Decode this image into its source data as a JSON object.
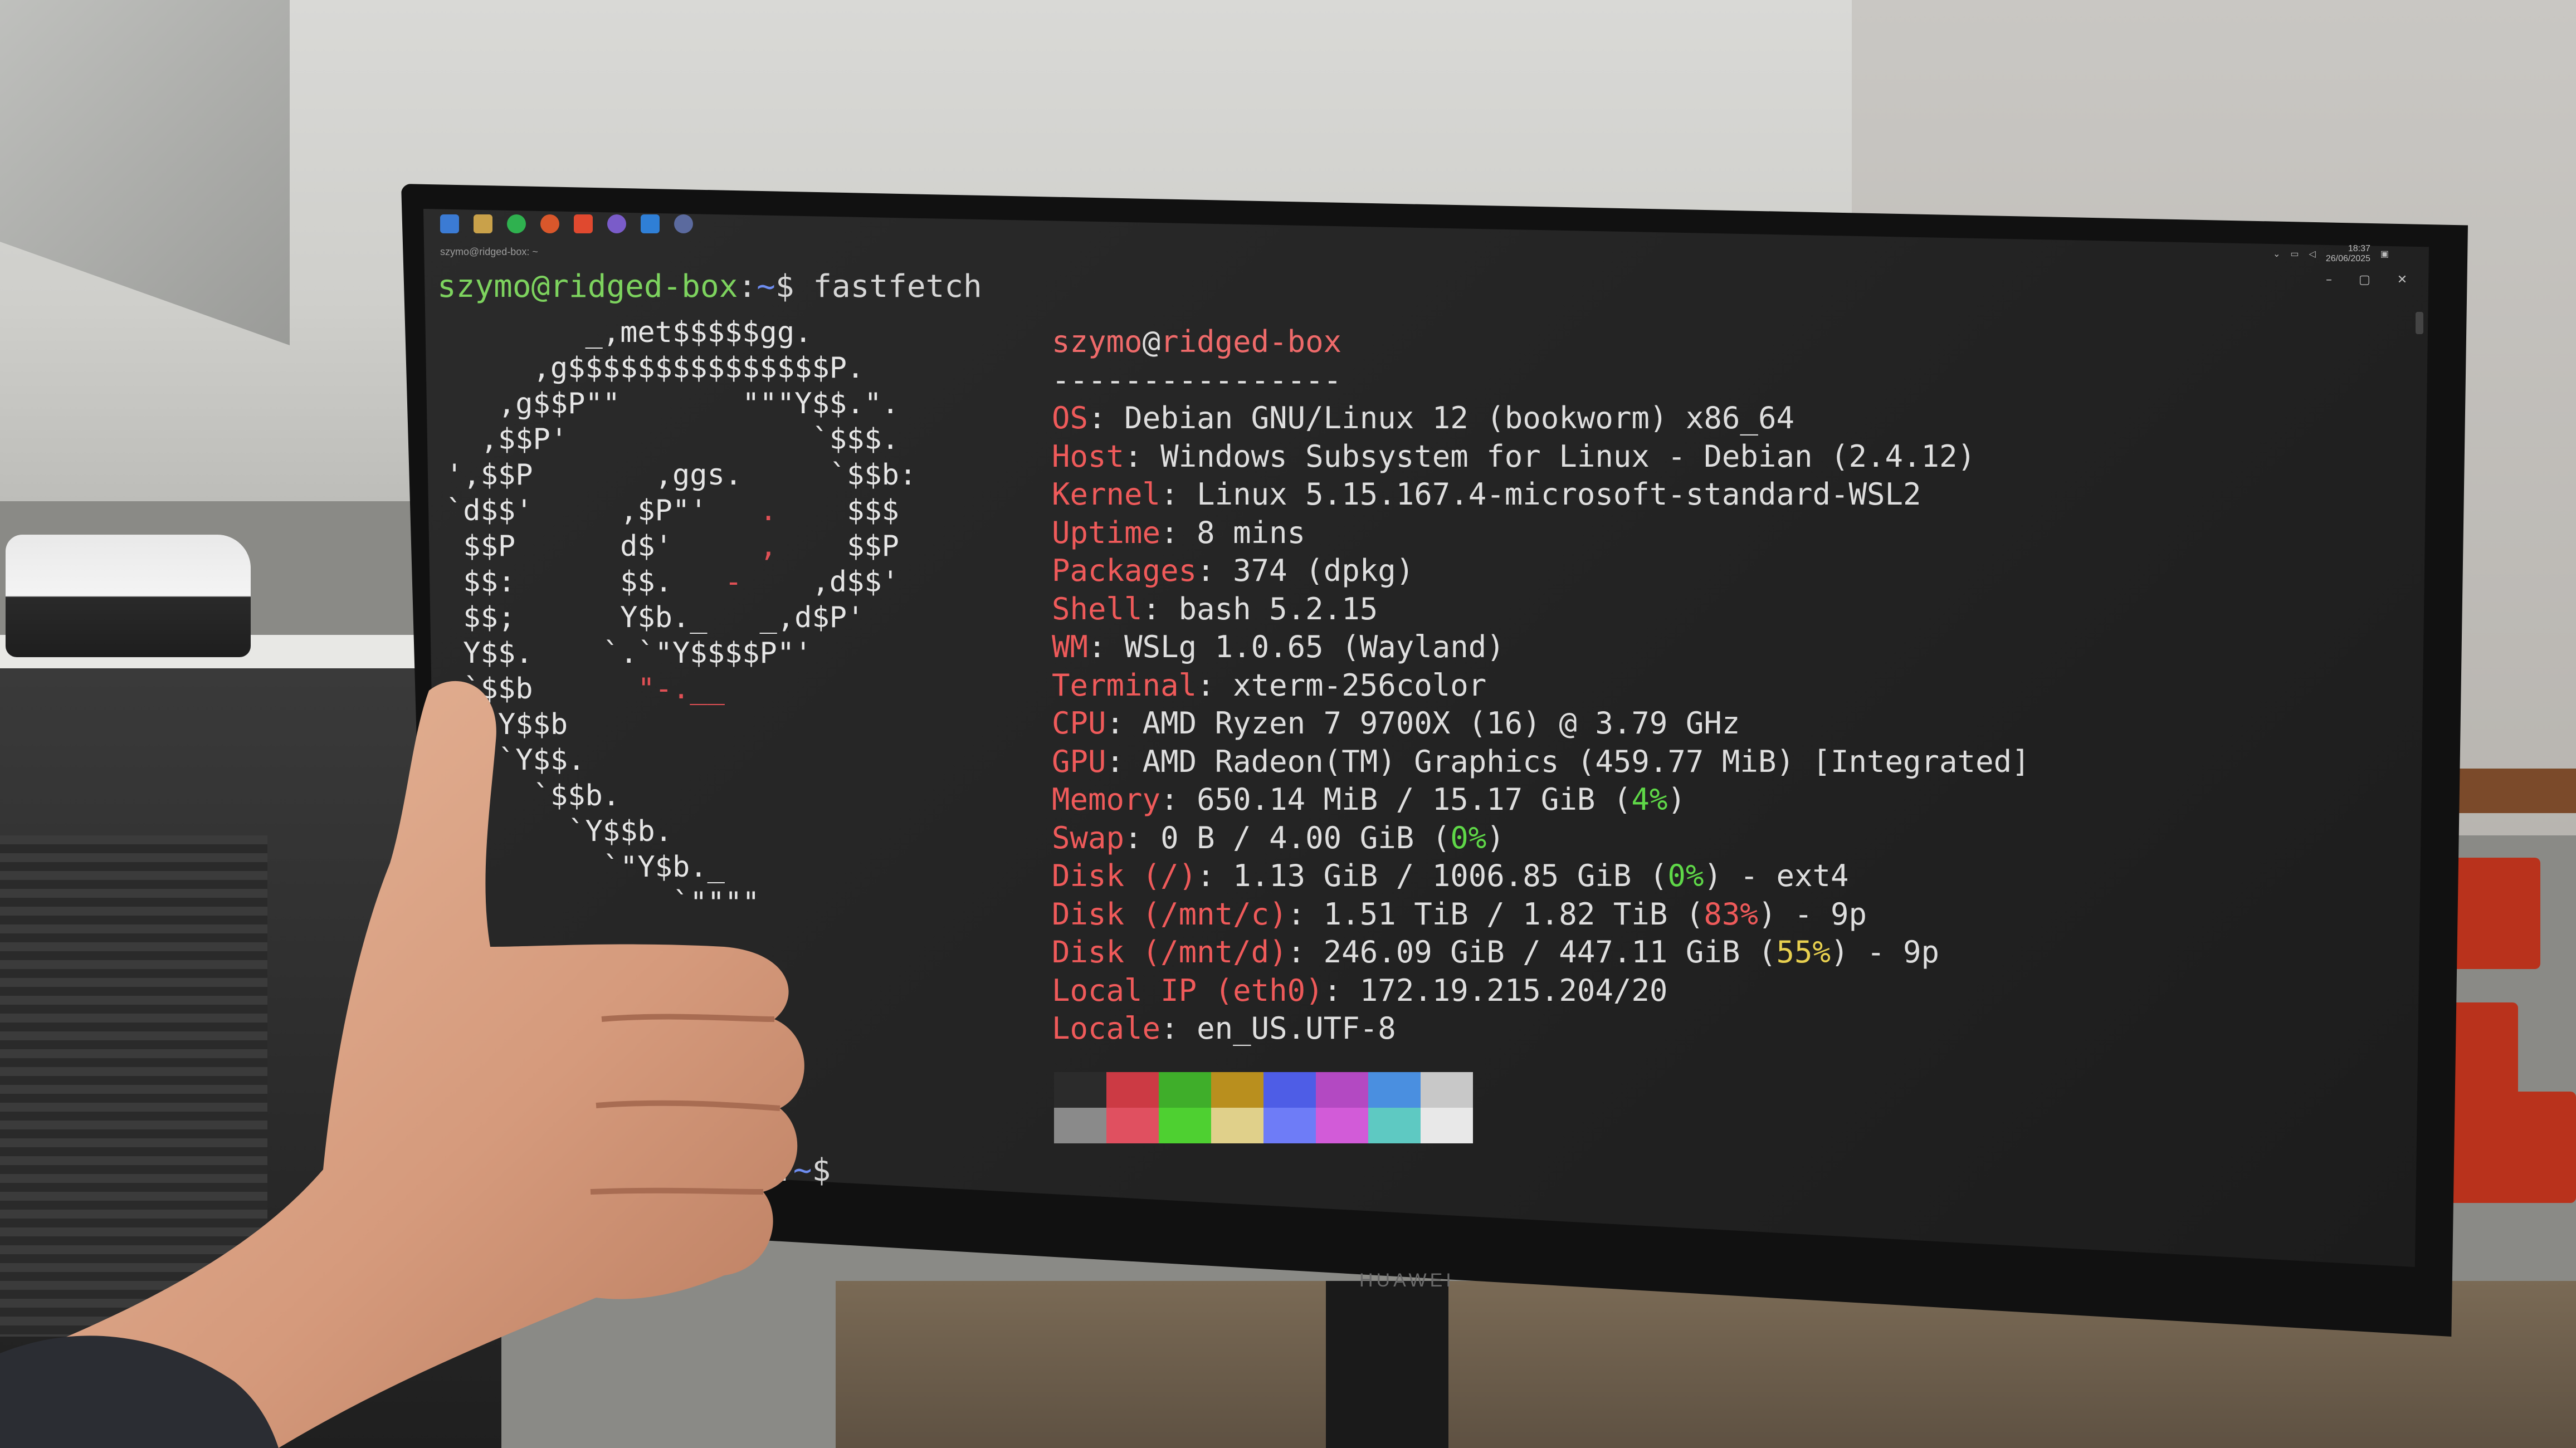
{
  "prompt": {
    "user_host": "szymo@ridged-box",
    "colon": ":",
    "path": "~",
    "dollar": "$ ",
    "command": "fastfetch"
  },
  "window": {
    "tab_title": "szymo@ridged-box: ~",
    "clock_time": "18:37",
    "clock_date": "26/06/2025"
  },
  "logo_lines": [
    "        _,met$$$$$gg.",
    "     ,g$$$$$$$$$$$$$$$P.",
    "   ,g$$P\"\"       \"\"\"Y$$.\".",
    "  ,$$P'              `$$$.",
    "',$$P       ,ggs.     `$$b:",
    "`d$$'     ,$P\"'   .    $$$",
    " $$P      d$'     ,    $$P",
    " $$:      $$.   -    ,d$$'",
    " $$;      Y$b._   _,d$P'",
    " Y$$.    `.`\"Y$$$$P\"'",
    " `$$b      \"-.__",
    "  `Y$$b",
    "   `Y$$.",
    "     `$$b.",
    "       `Y$$b.",
    "         `\"Y$b._",
    "             `\"\"\"\""
  ],
  "fetch": {
    "user": "szymo",
    "at": "@",
    "host": "ridged-box",
    "separator": "----------------",
    "rows": [
      {
        "key": "OS",
        "value": "Debian GNU/Linux 12 (bookworm) x86_64"
      },
      {
        "key": "Host",
        "value": "Windows Subsystem for Linux - Debian (2.4.12)"
      },
      {
        "key": "Kernel",
        "value": "Linux 5.15.167.4-microsoft-standard-WSL2"
      },
      {
        "key": "Uptime",
        "value": "8 mins"
      },
      {
        "key": "Packages",
        "value": "374 (dpkg)"
      },
      {
        "key": "Shell",
        "value": "bash 5.2.15"
      },
      {
        "key": "WM",
        "value": "WSLg 1.0.65 (Wayland)"
      },
      {
        "key": "Terminal",
        "value": "xterm-256color"
      },
      {
        "key": "CPU",
        "value": "AMD Ryzen 7 9700X (16) @ 3.79 GHz"
      },
      {
        "key": "GPU",
        "value": "AMD Radeon(TM) Graphics (459.77 MiB) [Integrated]"
      },
      {
        "key": "Memory",
        "pre": "650.14 MiB / 15.17 GiB (",
        "pct": "4%",
        "level": "ok",
        "post": ")"
      },
      {
        "key": "Swap",
        "pre": "0 B / 4.00 GiB (",
        "pct": "0%",
        "level": "ok",
        "post": ")"
      },
      {
        "key": "Disk (/)",
        "pre": "1.13 GiB / 1006.85 GiB (",
        "pct": "0%",
        "level": "ok",
        "post": ") - ext4"
      },
      {
        "key": "Disk (/mnt/c)",
        "pre": "1.51 TiB / 1.82 TiB (",
        "pct": "83%",
        "level": "hi",
        "post": ") - 9p"
      },
      {
        "key": "Disk (/mnt/d)",
        "pre": "246.09 GiB / 447.11 GiB (",
        "pct": "55%",
        "level": "mid",
        "post": ") - 9p"
      },
      {
        "key": "Local IP (eth0)",
        "value": "172.19.215.204/20"
      },
      {
        "key": "Locale",
        "value": "en_US.UTF-8"
      }
    ]
  },
  "palette": {
    "top": [
      "#2b2b2b",
      "#cc3a44",
      "#3fae2a",
      "#b98f1e",
      "#4e5de6",
      "#b349c2",
      "#4a8fe0",
      "#c8c8c8"
    ],
    "bottom": [
      "#8a8a8a",
      "#e05060",
      "#4ed031",
      "#e0d08a",
      "#6e7cf7",
      "#d25bd8",
      "#5ec9c2",
      "#e8e8e8"
    ]
  },
  "bottom_prompt": {
    "colon": ":",
    "path": "~",
    "dollar": "$"
  },
  "monitor_brand": "HUAWEI",
  "taskbar_icons": [
    "windows-icon",
    "folder-icon",
    "spotify-icon",
    "firefox-icon",
    "brave-icon",
    "github-icon",
    "vscode-icon",
    "steam-icon"
  ]
}
